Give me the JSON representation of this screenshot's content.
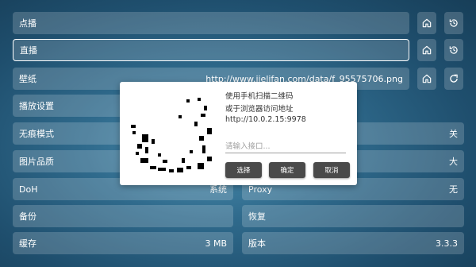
{
  "settings": {
    "vod": {
      "label": "点播"
    },
    "live": {
      "label": "直播"
    },
    "wallpaper": {
      "label": "壁纸",
      "value": "http://www.jielifan.com/data/f_95575706.png"
    },
    "playback": {
      "label": "播放设置"
    },
    "incognito": {
      "label": "无痕模式",
      "value": "关"
    },
    "image_quality": {
      "label": "图片品质",
      "value": "大"
    },
    "doh": {
      "label": "DoH",
      "value": "系统"
    },
    "proxy": {
      "label": "Proxy",
      "value": "无"
    },
    "backup": {
      "label": "备份"
    },
    "restore": {
      "label": "恢复"
    },
    "cache": {
      "label": "缓存",
      "value": "3 MB"
    },
    "version": {
      "label": "版本",
      "value": "3.3.3"
    }
  },
  "dialog": {
    "line1": "使用手机扫描二维码",
    "line2": "或于浏览器访问地址",
    "address": "http://10.0.2.15:9978",
    "input_placeholder": "请输入接口...",
    "btn_choose": "选择",
    "btn_confirm": "确定",
    "btn_cancel": "取消"
  },
  "icons": {
    "home": "home-icon",
    "history": "history-icon",
    "refresh": "refresh-icon"
  },
  "colors": {
    "button_dark": "#4a4a4a",
    "row_bg": "rgba(255,255,255,0.18)"
  }
}
